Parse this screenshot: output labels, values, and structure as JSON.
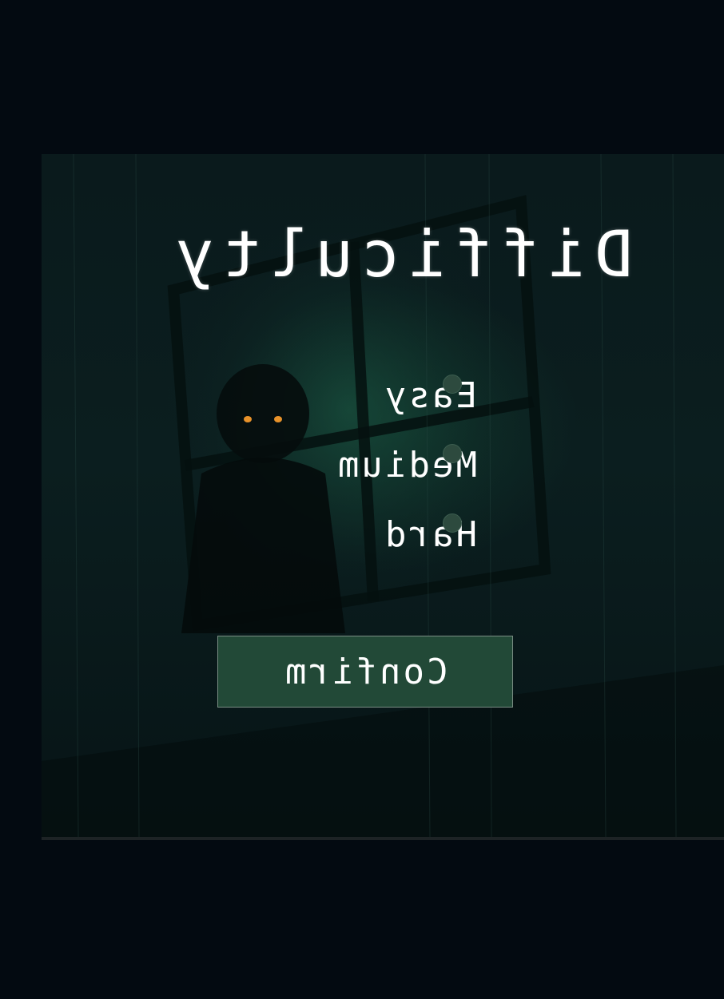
{
  "menu": {
    "title": "Difficulty",
    "options": [
      {
        "label": "Easy",
        "selected": false
      },
      {
        "label": "Medium",
        "selected": false
      },
      {
        "label": "Hard",
        "selected": false
      }
    ],
    "confirm_label": "Confirm"
  },
  "colors": {
    "page_background": "#030a11",
    "button_fill": "#224937",
    "radio_fill": "#2d4a3e",
    "text": "#ffffff"
  }
}
